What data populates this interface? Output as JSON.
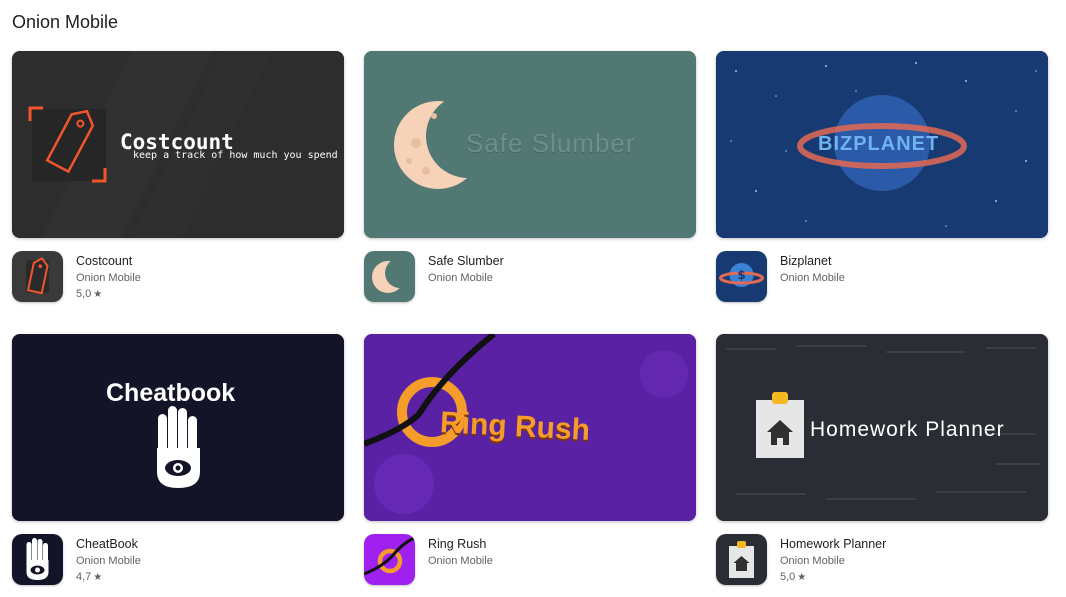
{
  "page": {
    "title": "Onion Mobile"
  },
  "colors": {
    "accent_orange": "#f2552c",
    "slumber_bg": "#517873",
    "moon": "#f6d3b8",
    "bizplanet_bg": "#173a72",
    "cheatbook_bg": "#141428",
    "ringrush_bg": "#5a21a5",
    "ring_orange": "#f59c2a",
    "homework_bg": "#2a2d33"
  },
  "apps": [
    {
      "name": "Costcount",
      "developer": "Onion Mobile",
      "rating": "5,0",
      "rating_icon": "star-icon",
      "banner": {
        "title": "Costcount",
        "subtitle": "keep a track of how much you spend"
      }
    },
    {
      "name": "Safe Slumber",
      "developer": "Onion Mobile",
      "rating": "",
      "banner": {
        "title": "Safe Slumber"
      }
    },
    {
      "name": "Bizplanet",
      "developer": "Onion Mobile",
      "rating": "",
      "banner": {
        "title": "BIZPLANET"
      }
    },
    {
      "name": "CheatBook",
      "developer": "Onion Mobile",
      "rating": "4,7",
      "rating_icon": "star-icon",
      "banner": {
        "title": "Cheatbook"
      }
    },
    {
      "name": "Ring Rush",
      "developer": "Onion Mobile",
      "rating": "",
      "banner": {
        "title": "Ring Rush"
      }
    },
    {
      "name": "Homework Planner",
      "developer": "Onion Mobile",
      "rating": "5,0",
      "rating_icon": "star-icon",
      "banner": {
        "title": "Homework Planner"
      }
    }
  ]
}
